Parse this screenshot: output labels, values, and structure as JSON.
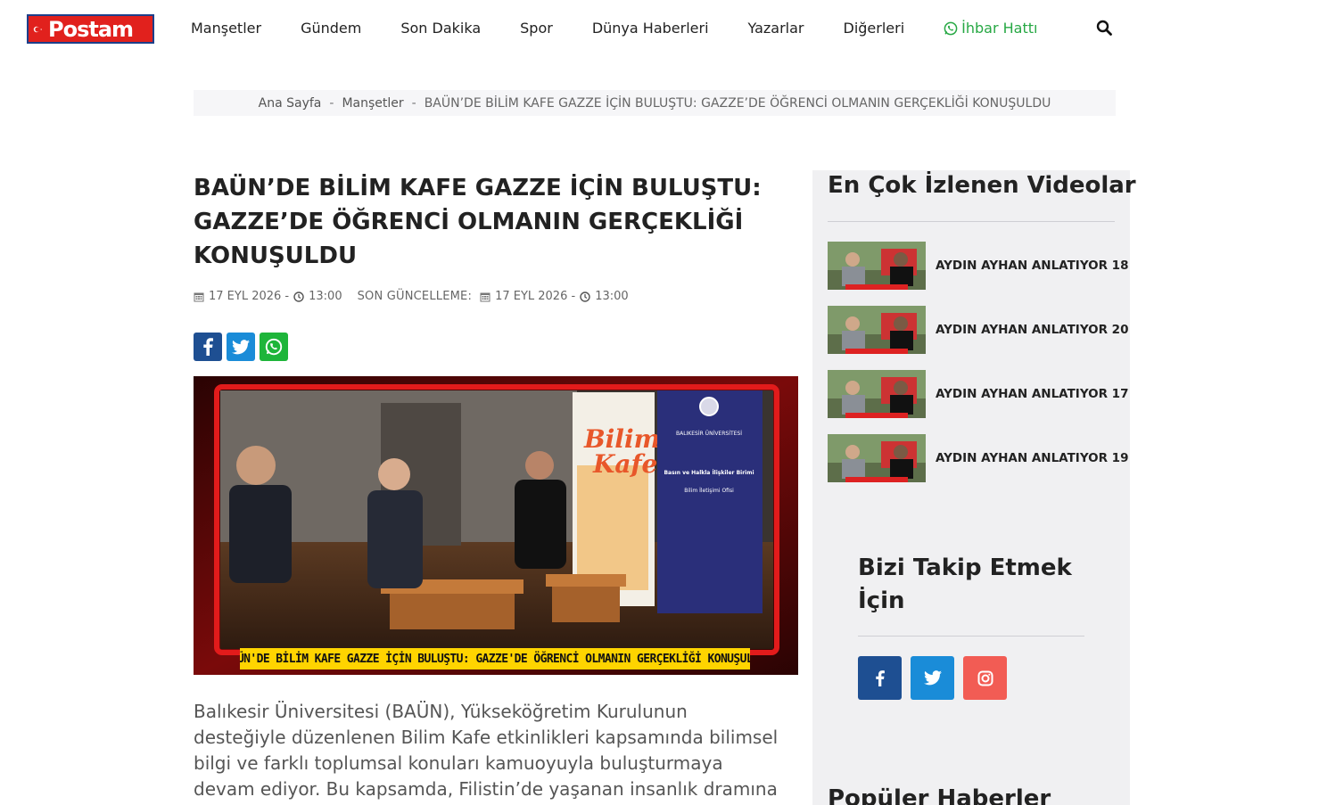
{
  "header": {
    "logo_text": "Postam",
    "nav": [
      {
        "label": "Manşetler"
      },
      {
        "label": "Gündem"
      },
      {
        "label": "Son Dakika"
      },
      {
        "label": "Spor"
      },
      {
        "label": "Dünya Haberleri"
      },
      {
        "label": "Yazarlar"
      },
      {
        "label": "Diğerleri"
      }
    ],
    "ihbar_label": "İhbar Hattı",
    "search_icon": "search-icon"
  },
  "breadcrumb": {
    "home": "Ana Sayfa",
    "sep": "-",
    "category": "Manşetler",
    "current": "BAÜN’DE BİLİM KAFE GAZZE İÇİN BULUŞTU: GAZZE’DE ÖĞRENCİ OLMANIN GERÇEKLİĞİ KONUŞULDU"
  },
  "article": {
    "title": "BAÜN’DE BİLİM KAFE GAZZE İÇİN BULUŞTU: GAZZE’DE ÖĞRENCİ OLMANIN GERÇEKLİĞİ KONUŞULDU",
    "date": "17 EYL 2026 -",
    "time": "13:00",
    "update_label": "SON GÜNCELLEME:",
    "update_date": "17 EYL 2026 -",
    "update_time": "13:00",
    "image_caption": "BAÜN'DE BİLİM KAFE GAZZE İÇİN BULUŞTU: GAZZE'DE ÖĞRENCİ OLMANIN GERÇEKLİĞİ KONUŞULDU",
    "banner_text_1": "Bilim",
    "banner_text_2": "Kafe",
    "banner_org": "BALIKESİR ÜNİVERSİTESİ",
    "banner_unit": "Basın ve Halkla İlişkiler Birimi",
    "banner_office": "Bilim İletişimi Ofisi",
    "body": "Balıkesir Üniversitesi (BAÜN), Yükseköğretim Kurulunun desteğiyle düzenlenen Bilim Kafe etkinlikleri kapsamında bilimsel bilgi ve farklı toplumsal konuları kamuoyuyla buluşturmaya devam ediyor. Bu kapsamda, Filistin’de yaşanan insanlık dramına dikkat çekmek ve"
  },
  "sidebar": {
    "videos_title": "En Çok İzlenen Videolar",
    "videos": [
      {
        "label": "AYDIN AYHAN ANLATIYOR 18"
      },
      {
        "label": "AYDIN AYHAN ANLATIYOR 20"
      },
      {
        "label": "AYDIN AYHAN ANLATIYOR 17"
      },
      {
        "label": "AYDIN AYHAN ANLATIYOR 19"
      }
    ],
    "follow_title": "Bizi Takip Etmek İçin",
    "popular_title": "Popüler Haberler"
  },
  "colors": {
    "facebook": "#1e4f92",
    "twitter": "#1a8cd8",
    "whatsapp": "#1eb53a",
    "instagram": "#f25c54",
    "ihbar": "#27a844",
    "logo_red": "#e1211d"
  }
}
